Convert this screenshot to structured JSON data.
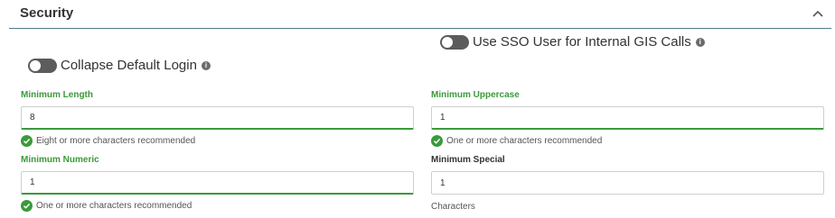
{
  "section": {
    "title": "Security"
  },
  "toggles": {
    "sso": {
      "label": "Use SSO User for Internal GIS Calls"
    },
    "collapse_login": {
      "label": "Collapse Default Login"
    }
  },
  "fields": {
    "min_length": {
      "label": "Minimum Length",
      "value": "8",
      "help": "Eight or more characters recommended"
    },
    "min_uppercase": {
      "label": "Minimum Uppercase",
      "value": "1",
      "help": "One or more characters recommended"
    },
    "min_numeric": {
      "label": "Minimum Numeric",
      "value": "1",
      "help": "One or more characters recommended"
    },
    "min_special": {
      "label": "Minimum Special",
      "value": "1",
      "help": "Characters"
    }
  }
}
